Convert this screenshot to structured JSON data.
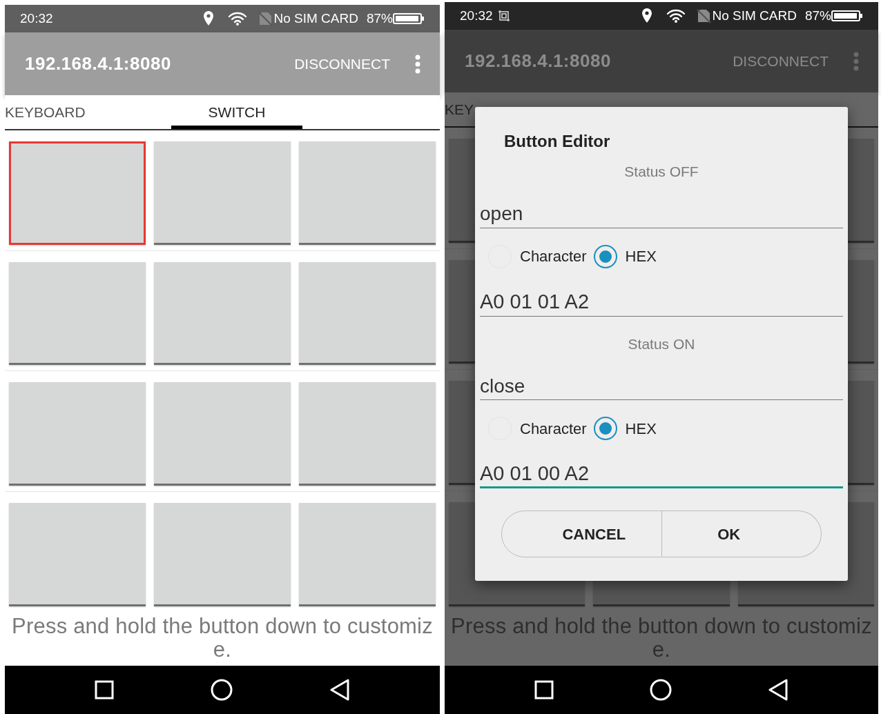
{
  "screens": [
    {
      "dimmed": false,
      "status_bar": {
        "time": "20:32",
        "screenshot_icon": false,
        "carrier": "No SIM CARD",
        "battery": "87%"
      },
      "app_bar": {
        "title": "192.168.4.1:8080",
        "action": "DISCONNECT"
      },
      "tabs": [
        {
          "label": "KEYBOARD",
          "selected": false
        },
        {
          "label": "SWITCH",
          "selected": true
        }
      ],
      "switch_buttons": [
        {
          "highlighted": true
        },
        {
          "highlighted": false
        },
        {
          "highlighted": false
        },
        {
          "highlighted": false
        },
        {
          "highlighted": false
        },
        {
          "highlighted": false
        },
        {
          "highlighted": false
        },
        {
          "highlighted": false
        },
        {
          "highlighted": false
        },
        {
          "highlighted": false
        },
        {
          "highlighted": false
        },
        {
          "highlighted": false
        }
      ],
      "hint": "Press and hold the button down to customize."
    },
    {
      "dimmed": true,
      "status_bar": {
        "time": "20:32",
        "screenshot_icon": true,
        "carrier": "No SIM CARD",
        "battery": "87%"
      },
      "app_bar": {
        "title": "192.168.4.1:8080",
        "action": "DISCONNECT"
      },
      "tabs": [
        {
          "label": "KEY",
          "selected": false
        }
      ],
      "hint": "Press and hold the button down to customize.",
      "dialog": {
        "title": "Button Editor",
        "sections": [
          {
            "heading": "Status OFF",
            "name": "open",
            "options": [
              {
                "label": "Character",
                "selected": false
              },
              {
                "label": "HEX",
                "selected": true
              }
            ],
            "code": "A0 01 01 A2",
            "focused": false
          },
          {
            "heading": "Status ON",
            "name": "close",
            "options": [
              {
                "label": "Character",
                "selected": false
              },
              {
                "label": "HEX",
                "selected": true
              }
            ],
            "code": "A0 01 00 A2",
            "focused": true
          }
        ],
        "buttons": [
          "CANCEL",
          "OK"
        ]
      }
    }
  ]
}
